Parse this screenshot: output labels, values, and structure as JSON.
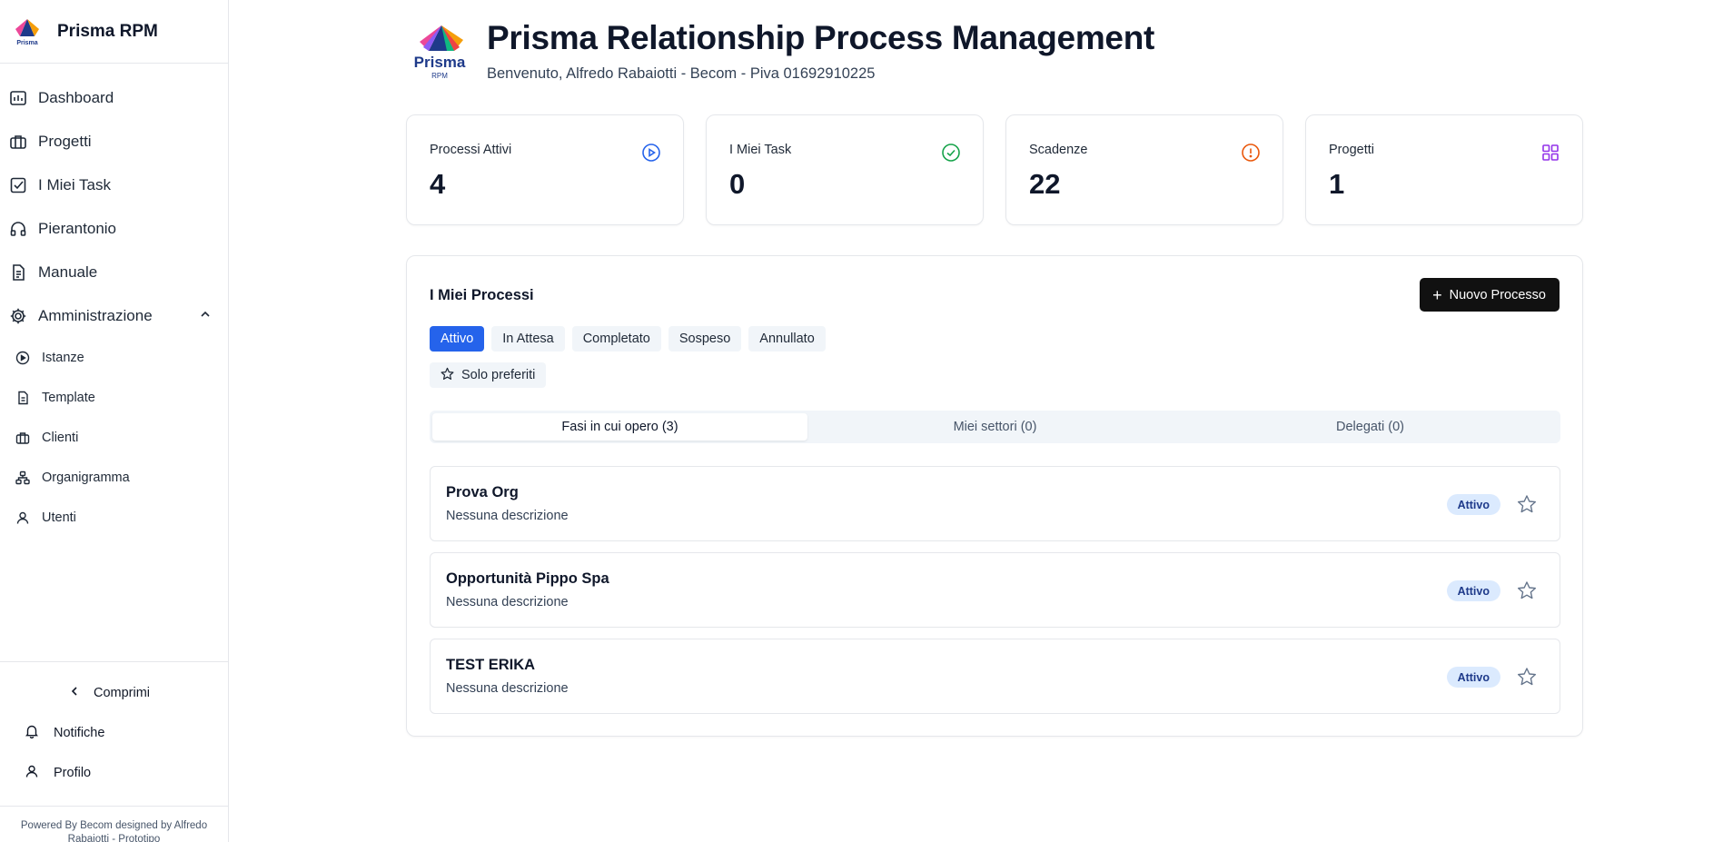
{
  "app": {
    "name": "Prisma RPM",
    "logo_text": "Prisma",
    "logo_subtext": "RPM"
  },
  "sidebar": {
    "items": [
      {
        "label": "Dashboard",
        "icon": "dashboard-icon"
      },
      {
        "label": "Progetti",
        "icon": "briefcase-icon"
      },
      {
        "label": "I Miei Task",
        "icon": "checkbox-icon"
      },
      {
        "label": "Pierantonio",
        "icon": "headphones-icon"
      },
      {
        "label": "Manuale",
        "icon": "document-icon"
      }
    ],
    "admin": {
      "label": "Amministrazione",
      "icon": "gear-icon",
      "expanded": true
    },
    "sub_items": [
      {
        "label": "Istanze",
        "icon": "play-circle-icon"
      },
      {
        "label": "Template",
        "icon": "document-icon"
      },
      {
        "label": "Clienti",
        "icon": "building-icon"
      },
      {
        "label": "Organigramma",
        "icon": "org-chart-icon"
      },
      {
        "label": "Utenti",
        "icon": "user-icon"
      }
    ],
    "collapse_label": "Comprimi",
    "notifications_label": "Notifiche",
    "profile_label": "Profilo",
    "footer": "Powered By Becom designed by Alfredo Rabaiotti - Prototipo"
  },
  "header": {
    "title": "Prisma Relationship Process Management",
    "subtitle": "Benvenuto, Alfredo Rabaiotti - Becom - Piva 01692910225"
  },
  "stats": [
    {
      "label": "Processi Attivi",
      "value": "4",
      "icon": "play-circle-icon",
      "color": "#2563eb"
    },
    {
      "label": "I Miei Task",
      "value": "0",
      "icon": "check-circle-icon",
      "color": "#16a34a"
    },
    {
      "label": "Scadenze",
      "value": "22",
      "icon": "alert-circle-icon",
      "color": "#ea580c"
    },
    {
      "label": "Progetti",
      "value": "1",
      "icon": "grid-icon",
      "color": "#9333ea"
    }
  ],
  "processes": {
    "title": "I Miei Processi",
    "new_button": "Nuovo Processo",
    "filters": [
      "Attivo",
      "In Attesa",
      "Completato",
      "Sospeso",
      "Annullato"
    ],
    "active_filter": "Attivo",
    "favorites_label": "Solo preferiti",
    "tabs": [
      "Fasi in cui opero (3)",
      "Miei settori (0)",
      "Delegati (0)"
    ],
    "active_tab": 0,
    "items": [
      {
        "title": "Prova Org",
        "description": "Nessuna descrizione",
        "status": "Attivo"
      },
      {
        "title": "Opportunità Pippo Spa",
        "description": "Nessuna descrizione",
        "status": "Attivo"
      },
      {
        "title": "TEST ERIKA",
        "description": "Nessuna descrizione",
        "status": "Attivo"
      }
    ]
  },
  "colors": {
    "accent": "#2563eb",
    "badge_bg": "#dbeafe",
    "badge_text": "#1e3a8a",
    "button_dark": "#111111"
  }
}
